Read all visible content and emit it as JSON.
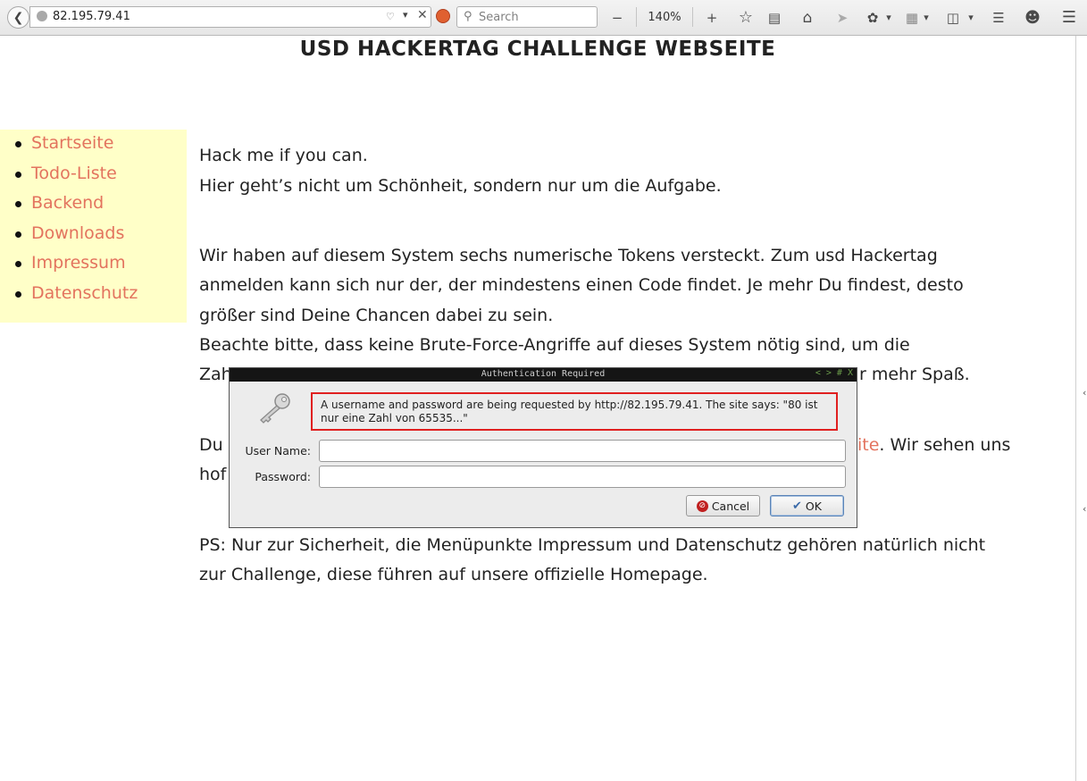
{
  "browser": {
    "url": "82.195.79.41",
    "search_placeholder": "Search",
    "zoom": "140%",
    "zoom_out": "−",
    "zoom_in": "+"
  },
  "page": {
    "title": "USD HACKERTAG CHALLENGE WEBSEITE",
    "nav": [
      "Startseite",
      "Todo-Liste",
      "Backend",
      "Downloads",
      "Impressum",
      "Datenschutz"
    ],
    "lines": [
      "Hack me if you can.",
      "Hier geht’s nicht um Schönheit, sondern nur um die Aufgabe.",
      "Wir haben auf diesem System sechs numerische Tokens versteckt. Zum usd Hackertag",
      "anmelden kann sich nur der, der mindestens einen Code findet. Je mehr Du findest, desto",
      "größer sind Deine Chancen dabei zu sein.",
      "Beachte bitte, dass keine Brute-Force-Angriffe auf dieses System nötig sind, um die",
      "Zah",
      "r mehr Spaß.",
      "Du",
      "ite",
      ". Wir sehen uns",
      "hof",
      "PS: Nur zur Sicherheit, die Menüpunkte Impressum und Datenschutz gehören natürlich nicht",
      "zur Challenge, diese führen auf unsere offizielle Homepage."
    ]
  },
  "dialog": {
    "title": "Authentication Required",
    "controls": "< > # X",
    "message": "A username and password are being requested by http://82.195.79.41. The site says: \"80 ist nur eine Zahl von 65535...\"",
    "username_label": "User Name:",
    "password_label": "Password:",
    "username_value": "",
    "password_value": "",
    "cancel_label": "Cancel",
    "ok_label": "OK"
  }
}
